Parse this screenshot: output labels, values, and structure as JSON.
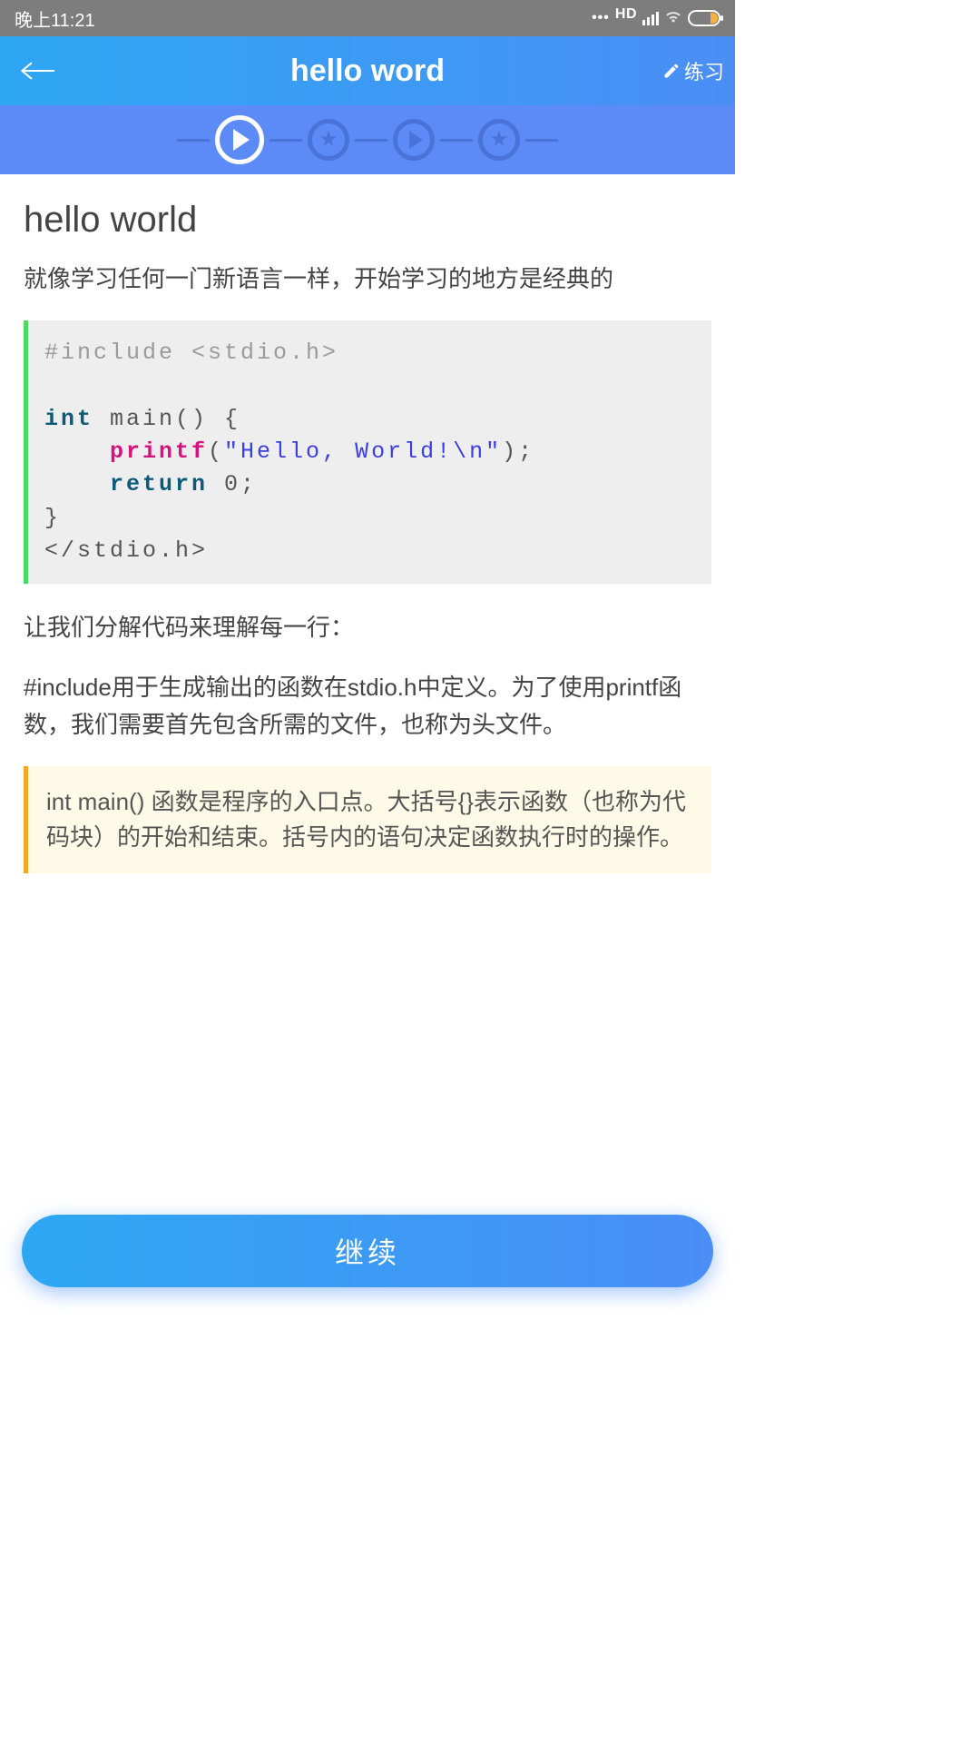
{
  "status": {
    "time": "晚上11:21",
    "hd": "HD"
  },
  "header": {
    "title": "hello word",
    "practice_label": "练习"
  },
  "progress": {
    "nodes": [
      "play",
      "star",
      "play",
      "star"
    ],
    "active_index": 0
  },
  "page": {
    "heading": "hello world",
    "intro": "就像学习任何一门新语言一样，开始学习的地方是经典的",
    "code": {
      "l1": "#include <stdio.h>",
      "l2_kw": "int",
      "l2_rest": " main() {",
      "l3_indent": "    ",
      "l3_fn": "printf",
      "l3_open": "(",
      "l3_str": "\"Hello, World!\\n\"",
      "l3_close": ");",
      "l4_indent": "    ",
      "l4_kw": "return",
      "l4_rest": " 0;",
      "l5": "}",
      "l6": "</stdio.h>"
    },
    "para2": "让我们分解代码来理解每一行：",
    "para3": "#include用于生成输出的函数在stdio.h中定义。为了使用printf函数，我们需要首先包含所需的文件，也称为头文件。",
    "note": "int main() 函数是程序的入口点。大括号{}表示函数（也称为代码块）的开始和结束。括号内的语句决定函数执行时的操作。"
  },
  "footer": {
    "continue_label": "继续"
  }
}
